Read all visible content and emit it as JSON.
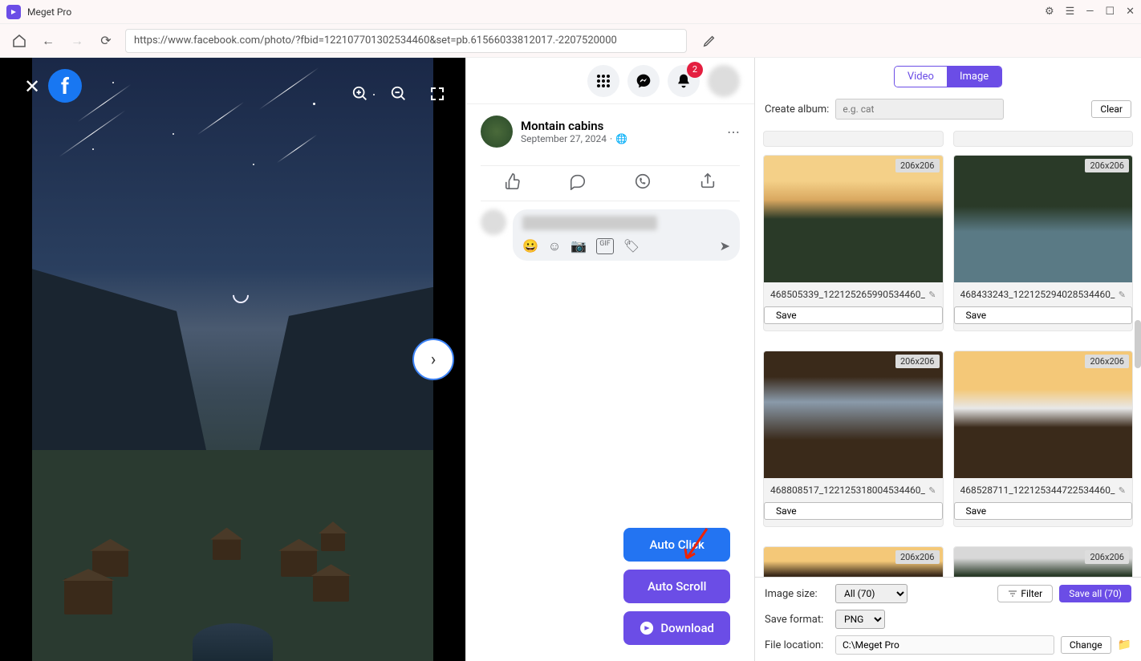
{
  "app": {
    "title": "Meget Pro"
  },
  "url": "https://www.facebook.com/photo/?fbid=122107701302534460&set=pb.61566033812017.-2207520000",
  "fb": {
    "notif_count": "2",
    "post_author": "Montain cabins",
    "post_date": "September 27, 2024",
    "globe": "·"
  },
  "float": {
    "autoclick": "Auto Click",
    "autoscroll": "Auto Scroll",
    "download": "Download"
  },
  "panel": {
    "tab_video": "Video",
    "tab_image": "Image",
    "album_label": "Create album:",
    "album_placeholder": "e.g. cat",
    "clear": "Clear",
    "size_label": "Image size:",
    "size_value": "All (70)",
    "filter": "Filter",
    "saveall": "Save all (70)",
    "format_label": "Save format:",
    "format_value": "PNG",
    "location_label": "File location:",
    "location_value": "C:\\Meget Pro",
    "change": "Change",
    "save": "Save"
  },
  "thumbs": [
    {
      "dim": "206x206",
      "name": "468505339_122125265990534460_"
    },
    {
      "dim": "206x206",
      "name": "468433243_122125294028534460_"
    },
    {
      "dim": "206x206",
      "name": "468808517_122125318004534460_"
    },
    {
      "dim": "206x206",
      "name": "468528711_122125344722534460_"
    },
    {
      "dim": "206x206",
      "name": ""
    },
    {
      "dim": "206x206",
      "name": ""
    }
  ]
}
